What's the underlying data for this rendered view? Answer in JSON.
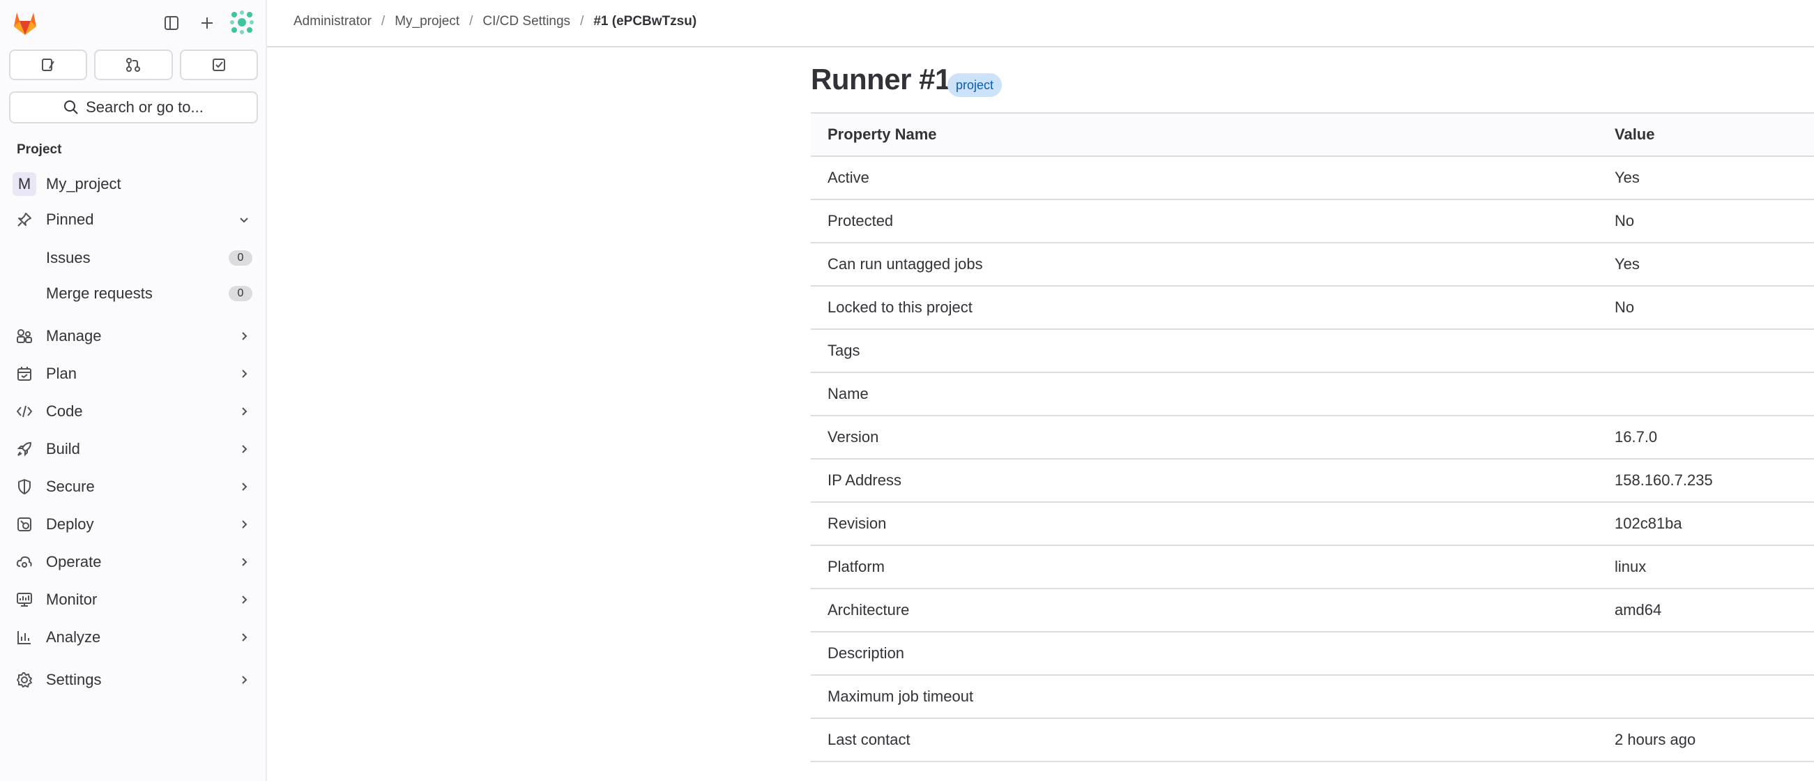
{
  "sidebar": {
    "search_label": "Search or go to...",
    "section_label": "Project",
    "project": {
      "initial": "M",
      "name": "My_project"
    },
    "pinned_label": "Pinned",
    "pinned_items": [
      {
        "label": "Issues",
        "count": "0"
      },
      {
        "label": "Merge requests",
        "count": "0"
      }
    ],
    "nav": [
      "Manage",
      "Plan",
      "Code",
      "Build",
      "Secure",
      "Deploy",
      "Operate",
      "Monitor",
      "Analyze",
      "Settings"
    ]
  },
  "breadcrumb": [
    "Administrator",
    "My_project",
    "CI/CD Settings",
    "#1 (ePCBwTzsu)"
  ],
  "page": {
    "title": "Runner #1",
    "badge": "project"
  },
  "table": {
    "headers": [
      "Property Name",
      "Value"
    ],
    "rows": [
      [
        "Active",
        "Yes"
      ],
      [
        "Protected",
        "No"
      ],
      [
        "Can run untagged jobs",
        "Yes"
      ],
      [
        "Locked to this project",
        "No"
      ],
      [
        "Tags",
        ""
      ],
      [
        "Name",
        ""
      ],
      [
        "Version",
        "16.7.0"
      ],
      [
        "IP Address",
        "158.160.7.235"
      ],
      [
        "Revision",
        "102c81ba"
      ],
      [
        "Platform",
        "linux"
      ],
      [
        "Architecture",
        "amd64"
      ],
      [
        "Description",
        ""
      ],
      [
        "Maximum job timeout",
        ""
      ],
      [
        "Last contact",
        "2 hours ago"
      ]
    ]
  },
  "colors": {
    "badge_bg": "#cbe2f9",
    "badge_text": "#0b5cad",
    "logo": "#e24329"
  }
}
